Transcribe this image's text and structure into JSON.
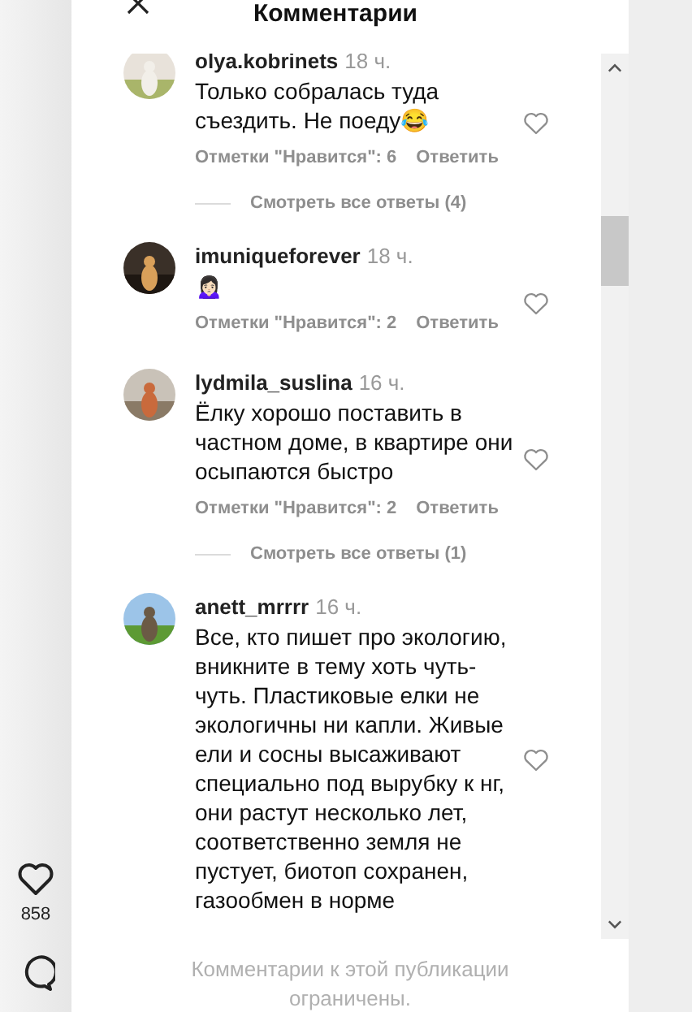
{
  "header": {
    "title": "Комментарии"
  },
  "side": {
    "likes": "858"
  },
  "comments": [
    {
      "username": "olya.kobrinets",
      "time": "18 ч.",
      "text": "Только собралась туда съездить. Не поеду😂",
      "likes": "Отметки \"Нравится\": 6",
      "reply": "Ответить",
      "view_replies": "Смотреть все ответы (4)"
    },
    {
      "username": "imuniqueforever",
      "time": "18 ч.",
      "text": "🙍🏻‍♀️",
      "likes": "Отметки \"Нравится\": 2",
      "reply": "Ответить"
    },
    {
      "username": "lydmila_suslina",
      "time": "16 ч.",
      "text": "Ёлку хорошо поставить в частном доме, в квартире они осыпаются быстро",
      "likes": "Отметки \"Нравится\": 2",
      "reply": "Ответить",
      "view_replies": "Смотреть все ответы (1)"
    },
    {
      "username": "anett_mrrrr",
      "time": "16 ч.",
      "text": "Все, кто пишет про экологию, вникните в тему хоть чуть-чуть. Пластиковые елки не экологичны ни капли. Живые ели и сосны высаживают специально под вырубку к нг, они растут несколько лет, соответственно земля не пустует, биотоп сохранен, газообмен в норме"
    }
  ],
  "footer": {
    "text": "Комментарии к этой публикации ограничены."
  }
}
